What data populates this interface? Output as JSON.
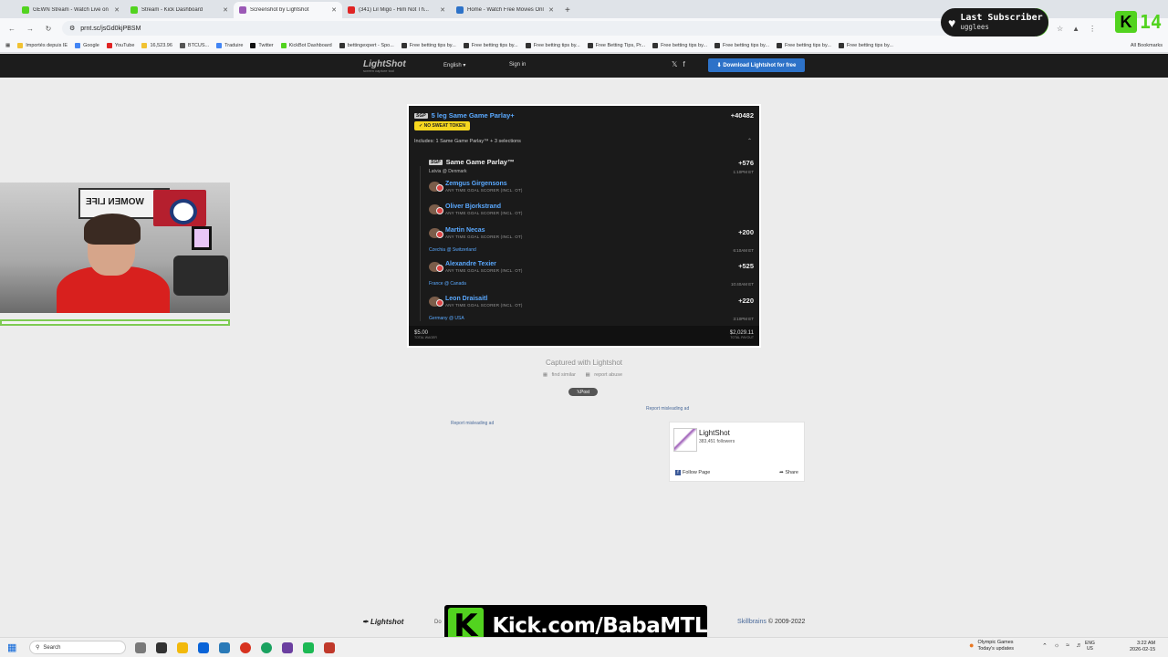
{
  "browser": {
    "tabs": [
      {
        "title": "GEWN Stream - Watch Live on",
        "color": "#52d31f",
        "active": false
      },
      {
        "title": "Stream - Kick Dashboard",
        "color": "#52d31f",
        "active": false
      },
      {
        "title": "Screenshot by Lightshot",
        "color": "#9b59b6",
        "active": true
      },
      {
        "title": "(341) Lil Migo - Him Not Th...",
        "color": "#e02424",
        "active": false
      },
      {
        "title": "Home - Watch Free Movies Onl",
        "color": "#2d72c8",
        "active": false
      }
    ],
    "url": "prnt.sc/jsGd0kjPBSM",
    "bookmarks": [
      {
        "label": "Importés depuis IE",
        "color": "#f1c232"
      },
      {
        "label": "Google",
        "color": "#4285f4"
      },
      {
        "label": "YouTube",
        "color": "#e02424"
      },
      {
        "label": "16,523.96",
        "color": "#f1c232"
      },
      {
        "label": "BTCUS...",
        "color": "#555555"
      },
      {
        "label": "Traduire",
        "color": "#4285f4"
      },
      {
        "label": "Twitter",
        "color": "#111111"
      },
      {
        "label": "KickBot Dashboard",
        "color": "#52d31f"
      },
      {
        "label": "bettingexpert - Spo...",
        "color": "#333333"
      },
      {
        "label": "Free betting tips by...",
        "color": "#333333"
      },
      {
        "label": "Free betting tips by...",
        "color": "#333333"
      },
      {
        "label": "Free betting tips by...",
        "color": "#333333"
      },
      {
        "label": "Free Betting Tips, Pr...",
        "color": "#333333"
      },
      {
        "label": "Free betting tips by...",
        "color": "#333333"
      },
      {
        "label": "Free betting tips by...",
        "color": "#333333"
      },
      {
        "label": "Free betting tips by...",
        "color": "#333333"
      },
      {
        "label": "Free betting tips by...",
        "color": "#333333"
      }
    ],
    "all_bookmarks": "All Bookmarks"
  },
  "lightshot": {
    "logo": "LightShot",
    "tagline": "screen capture tool",
    "language": "English",
    "signin": "Sign in",
    "download": "Download Lightshot for free",
    "captured": "Captured with Lightshot",
    "find_similar": "find similar",
    "report_abuse": "report abuse",
    "post": "Post",
    "report_ad_1": "Report misleading ad",
    "report_ad_2": "Report misleading ad",
    "fb_name": "LightShot",
    "fb_followers": "383,451 followers",
    "fb_follow": "Follow Page",
    "fb_share": "Share",
    "footer_logo": "Lightshot",
    "footer_dl": "Do",
    "footer_company": "Skillbrains",
    "footer_copy": " © 2009-2022"
  },
  "bet": {
    "badge": "SGP",
    "title": "5 leg Same Game Parlay+",
    "odds": "+40482",
    "token": "NO SWEAT TOKEN",
    "includes": "Includes: 1 Same Game Parlay™ + 3 selections",
    "sgp_title": "Same Game Parlay™",
    "sgp_odds": "+576",
    "sgp_game": "Latvia @ Denmark",
    "sgp_time": "1:10PM ET",
    "legs": [
      {
        "name": "Zemgus Girgensons",
        "type": "ANY TIME GOAL SCORER (INCL. OT)"
      },
      {
        "name": "Oliver Bjorkstrand",
        "type": "ANY TIME GOAL SCORER (INCL. OT)"
      },
      {
        "name": "Martin Necas",
        "type": "ANY TIME GOAL SCORER (INCL. OT)",
        "odds": "+200",
        "game": "Czechia @ Switzerland",
        "time": "6:10AM ET"
      },
      {
        "name": "Alexandre Texier",
        "type": "ANY TIME GOAL SCORER (INCL. OT)",
        "odds": "+525",
        "game": "France @ Canada",
        "time": "10:40AM ET"
      },
      {
        "name": "Leon Draisaitl",
        "type": "ANY TIME GOAL SCORER (INCL. OT)",
        "odds": "+220",
        "game": "Germany @ USA",
        "time": "3:10PM ET"
      }
    ],
    "wager": "$5.00",
    "wager_label": "TOTAL WAGER",
    "payout": "$2,029.11",
    "payout_label": "TOTAL PAYOUT"
  },
  "overlay": {
    "alert_label": "Last Subscriber",
    "alert_user": "ugglees",
    "kick_count": "14",
    "kick_letter": "K",
    "banner_text": "Kick.com/BabaMTL"
  },
  "taskbar": {
    "search": "Search",
    "weather_title": "Olympic Games",
    "weather_sub": "Today's updates",
    "lang1": "ENG",
    "lang2": "US",
    "time": "3:22 AM",
    "date": "2026-02-15"
  }
}
